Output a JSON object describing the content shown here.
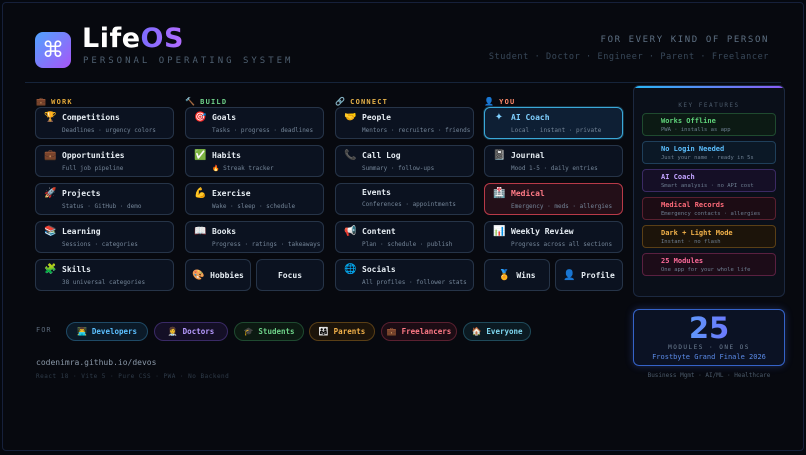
{
  "header": {
    "logo_glyph": "⌘",
    "brand_a": "Life",
    "brand_b": "OS",
    "subtitle": "PERSONAL OPERATING SYSTEM",
    "tagline": "FOR EVERY KIND OF PERSON",
    "roles": "Student · Doctor · Engineer · Parent · Freelancer"
  },
  "columns": [
    {
      "label": "WORK",
      "icon": "💼",
      "color": "#e3a93a"
    },
    {
      "label": "BUILD",
      "icon": "🔨",
      "color": "#6fd38a"
    },
    {
      "label": "CONNECT",
      "icon": "🔗",
      "color": "#e6b24a"
    },
    {
      "label": "YOU",
      "icon": "👤",
      "color": "#ff8a6a"
    }
  ],
  "cards": {
    "competitions": {
      "icon": "🏆",
      "title": "Competitions",
      "sub": "Deadlines · urgency colors"
    },
    "opportunities": {
      "icon": "💼",
      "title": "Opportunities",
      "sub": "Full job pipeline"
    },
    "projects": {
      "icon": "🚀",
      "title": "Projects",
      "sub": "Status · GitHub · demo"
    },
    "learning": {
      "icon": "📚",
      "title": "Learning",
      "sub": "Sessions · categories"
    },
    "skills": {
      "icon": "🧩",
      "title": "Skills",
      "sub": "38 universal categories"
    },
    "goals": {
      "icon": "🎯",
      "title": "Goals",
      "sub": "Tasks · progress · deadlines"
    },
    "habits": {
      "icon": "✅",
      "title": "Habits",
      "sub": "🔥 Streak tracker"
    },
    "exercise": {
      "icon": "💪",
      "title": "Exercise",
      "sub": "Wake · sleep · schedule"
    },
    "books": {
      "icon": "📖",
      "title": "Books",
      "sub": "Progress · ratings · takeaways"
    },
    "hobbies": {
      "icon": "🎨",
      "title": "Hobbies"
    },
    "focus": {
      "icon": "",
      "title": "Focus"
    },
    "people": {
      "icon": "🤝",
      "title": "People",
      "sub": "Mentors · recruiters · friends"
    },
    "calllog": {
      "icon": "📞",
      "title": "Call Log",
      "sub": "Summary · follow-ups"
    },
    "events": {
      "icon": "",
      "title": "Events",
      "sub": "Conferences · appointments"
    },
    "content": {
      "icon": "📢",
      "title": "Content",
      "sub": "Plan · schedule · publish"
    },
    "socials": {
      "icon": "🌐",
      "title": "Socials",
      "sub": "All profiles · follower stats"
    },
    "aicoach": {
      "icon": "✦",
      "title": "AI Coach",
      "sub": "Local · instant · private"
    },
    "journal": {
      "icon": "📓",
      "title": "Journal",
      "sub": "Mood 1-5 · daily entries"
    },
    "medical": {
      "icon": "🏥",
      "title": "Medical",
      "sub": "Emergency · meds · allergies"
    },
    "review": {
      "icon": "📊",
      "title": "Weekly Review",
      "sub": "Progress across all sections"
    },
    "wins": {
      "icon": "🏅",
      "title": "Wins"
    },
    "profile": {
      "icon": "👤",
      "title": "Profile"
    }
  },
  "features": {
    "title": "KEY FEATURES",
    "items": [
      {
        "title": "Works Offline",
        "sub": "PWA · installs as app",
        "color": "#5fd37a",
        "border": "#1f4a2f",
        "bg": "#0c1a14"
      },
      {
        "title": "No Login Needed",
        "sub": "Just your name · ready in 5s",
        "color": "#5cc0ff",
        "border": "#1f3f5a",
        "bg": "#0b1826"
      },
      {
        "title": "AI Coach",
        "sub": "Smart analysis · no API cost",
        "color": "#c2a3ff",
        "border": "#3b2a63",
        "bg": "#150f26"
      },
      {
        "title": "Medical Records",
        "sub": "Emergency contacts · allergies",
        "color": "#ff6b7a",
        "border": "#5a2030",
        "bg": "#1c0c14"
      },
      {
        "title": "Dark + Light Mode",
        "sub": "Instant · no flash",
        "color": "#f3b24a",
        "border": "#5a3f16",
        "bg": "#1c140a"
      },
      {
        "title": "25 Modules",
        "sub": "One app for your whole life",
        "color": "#ff6b9a",
        "border": "#5a2040",
        "bg": "#1c0c18"
      }
    ]
  },
  "counter": {
    "number": "25",
    "label": "MODULES · ONE OS",
    "event": "Frostbyte Grand Finale 2026"
  },
  "verticals": "Business Mgmt · AI/ML · Healthcare",
  "audience": {
    "label": "FOR",
    "pills": [
      {
        "icon": "👨‍💻",
        "label": "Developers",
        "color": "#5cc0ff",
        "border": "#1f4a66",
        "bg": "#0b1a28"
      },
      {
        "icon": "👩‍⚕️",
        "label": "Doctors",
        "color": "#b79bff",
        "border": "#3a2a66",
        "bg": "#140f26"
      },
      {
        "icon": "🎓",
        "label": "Students",
        "color": "#6fd38a",
        "border": "#1f4a30",
        "bg": "#0c1a12"
      },
      {
        "icon": "👨‍👩‍👧",
        "label": "Parents",
        "color": "#f3b24a",
        "border": "#5a3f16",
        "bg": "#1c140a"
      },
      {
        "icon": "💼",
        "label": "Freelancers",
        "color": "#ff7a86",
        "border": "#5a2030",
        "bg": "#1c0c14"
      },
      {
        "icon": "🏠",
        "label": "Everyone",
        "color": "#7fd8f0",
        "border": "#1f4a5a",
        "bg": "#0b1a22"
      }
    ]
  },
  "footer": {
    "url": "codenimra.github.io/devos",
    "stack": "React 18 · Vite 5 · Pure CSS · PWA · No Backend"
  }
}
